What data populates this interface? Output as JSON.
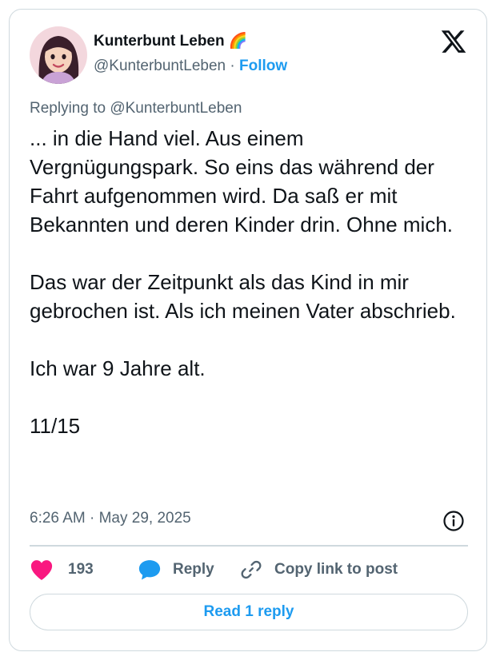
{
  "author": {
    "display_name": "Kunterbunt Leben 🌈",
    "handle": "@KunterbuntLeben",
    "separator": "·",
    "follow_label": "Follow"
  },
  "reply_context": {
    "prefix": "Replying to",
    "mention": "@KunterbuntLeben"
  },
  "tweet": {
    "paragraphs": [
      "... in die Hand viel. Aus einem Vergnügungspark. So eins das während der Fahrt aufgenommen wird. Da saß er mit Bekannten und deren Kinder drin. Ohne mich.",
      "Das war der Zeitpunkt als das Kind in mir gebrochen ist. Als ich meinen Vater abschrieb.",
      "Ich war 9 Jahre alt.",
      "11/15"
    ],
    "timestamp": "6:26 AM · May 29, 2025"
  },
  "actions": {
    "like_count": "193",
    "reply_label": "Reply",
    "copy_label": "Copy link to post"
  },
  "read_replies_label": "Read 1 reply",
  "colors": {
    "accent": "#1d9bf0",
    "heart": "#f91880",
    "secondary_text": "#536471",
    "border": "#cfd9de"
  },
  "icons": [
    "x-logo-icon",
    "info-icon",
    "heart-icon",
    "reply-bubble-icon",
    "link-icon"
  ]
}
